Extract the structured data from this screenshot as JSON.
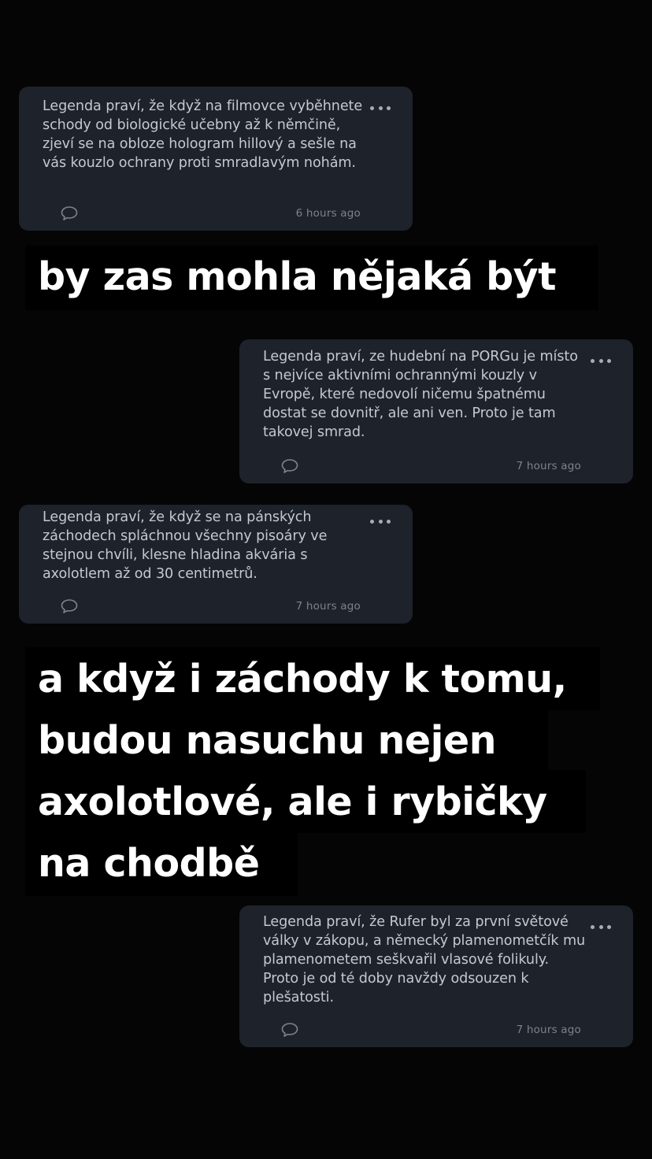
{
  "cards": [
    {
      "text": "Legenda praví, že když na filmovce vyběhnete schody od biologické učebny až k němčině, zjeví se na obloze hologram hillový a sešle na vás kouzlo ochrany proti smradlavým nohám.",
      "time": "6 hours ago"
    },
    {
      "text": "Legenda praví, ze hudební na PORGu je místo s nejvíce aktivními ochrannými kouzly v Evropě, které nedovolí ničemu špatnému dostat se dovnitř, ale ani ven. Proto je tam takovej smrad.",
      "time": "7 hours ago"
    },
    {
      "text": "Legenda praví, že když se na pánských záchodech spláchnou všechny pisoáry ve stejnou chvíli, klesne hladina akvária s axolotlem až od 30 centimetrů.",
      "time": "7 hours ago"
    },
    {
      "text": "Legenda praví, že Rufer byl za první světové války v zákopu, a německý plamenometčík mu plamenometem seškvařil vlasové folikuly. Proto je od té doby navždy odsouzen k plešatosti.",
      "time": "7 hours ago"
    }
  ],
  "captions": {
    "first_line": "by zas mohla nějaká být",
    "second_lines": [
      "a když i záchody k tomu,",
      "budou nasuchu nejen",
      "axolotlové, ale i rybičky",
      "na chodbě"
    ]
  },
  "icons": {
    "more": "more-horizontal-icon",
    "comment": "speech-bubble-icon"
  },
  "colors": {
    "background": "#050506",
    "card": "#1e222b",
    "card_text": "#c3c8d3",
    "meta_text": "#7d828e",
    "caption_text": "#ffffff"
  }
}
